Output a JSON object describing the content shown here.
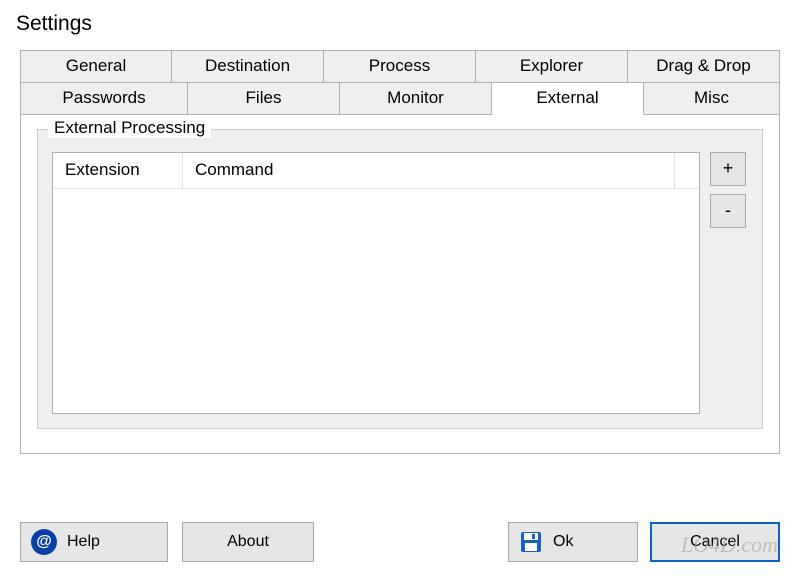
{
  "window": {
    "title": "Settings"
  },
  "tabs": {
    "row1": [
      {
        "label": "General"
      },
      {
        "label": "Destination"
      },
      {
        "label": "Process"
      },
      {
        "label": "Explorer"
      },
      {
        "label": "Drag & Drop"
      }
    ],
    "row2": [
      {
        "label": "Passwords"
      },
      {
        "label": "Files"
      },
      {
        "label": "Monitor"
      },
      {
        "label": "External",
        "active": true
      },
      {
        "label": "Misc"
      }
    ]
  },
  "group": {
    "title": "External Processing"
  },
  "listview": {
    "columns": [
      "Extension",
      "Command"
    ]
  },
  "side": {
    "add": "+",
    "remove": "-"
  },
  "footer": {
    "help": "Help",
    "about": "About",
    "ok": "Ok",
    "cancel": "Cancel"
  },
  "watermark": "LO4D.com"
}
